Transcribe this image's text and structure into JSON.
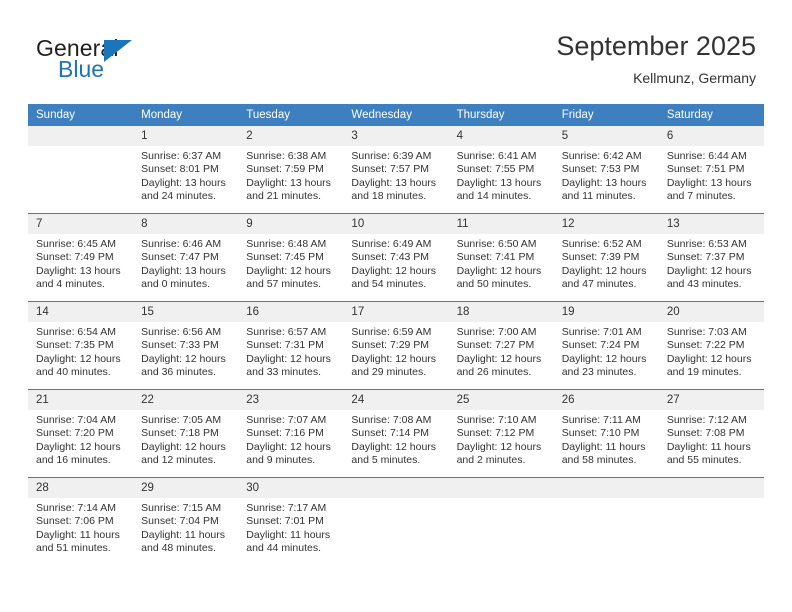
{
  "brand": {
    "name_part1": "General",
    "name_part2": "Blue",
    "accent_color": "#1b75bb"
  },
  "header": {
    "title": "September 2025",
    "subtitle": "Kellmunz, Germany",
    "header_bg_color": "#3d7fbf",
    "daynum_band_color": "#f0f0f0"
  },
  "weekdays": [
    "Sunday",
    "Monday",
    "Tuesday",
    "Wednesday",
    "Thursday",
    "Friday",
    "Saturday"
  ],
  "labels": {
    "sunrise": "Sunrise:",
    "sunset": "Sunset:",
    "daylight": "Daylight:"
  },
  "weeks": [
    [
      {
        "day": "",
        "sunrise": "",
        "sunset": "",
        "daylight": ""
      },
      {
        "day": "1",
        "sunrise": "Sunrise: 6:37 AM",
        "sunset": "Sunset: 8:01 PM",
        "daylight": "Daylight: 13 hours and 24 minutes."
      },
      {
        "day": "2",
        "sunrise": "Sunrise: 6:38 AM",
        "sunset": "Sunset: 7:59 PM",
        "daylight": "Daylight: 13 hours and 21 minutes."
      },
      {
        "day": "3",
        "sunrise": "Sunrise: 6:39 AM",
        "sunset": "Sunset: 7:57 PM",
        "daylight": "Daylight: 13 hours and 18 minutes."
      },
      {
        "day": "4",
        "sunrise": "Sunrise: 6:41 AM",
        "sunset": "Sunset: 7:55 PM",
        "daylight": "Daylight: 13 hours and 14 minutes."
      },
      {
        "day": "5",
        "sunrise": "Sunrise: 6:42 AM",
        "sunset": "Sunset: 7:53 PM",
        "daylight": "Daylight: 13 hours and 11 minutes."
      },
      {
        "day": "6",
        "sunrise": "Sunrise: 6:44 AM",
        "sunset": "Sunset: 7:51 PM",
        "daylight": "Daylight: 13 hours and 7 minutes."
      }
    ],
    [
      {
        "day": "7",
        "sunrise": "Sunrise: 6:45 AM",
        "sunset": "Sunset: 7:49 PM",
        "daylight": "Daylight: 13 hours and 4 minutes."
      },
      {
        "day": "8",
        "sunrise": "Sunrise: 6:46 AM",
        "sunset": "Sunset: 7:47 PM",
        "daylight": "Daylight: 13 hours and 0 minutes."
      },
      {
        "day": "9",
        "sunrise": "Sunrise: 6:48 AM",
        "sunset": "Sunset: 7:45 PM",
        "daylight": "Daylight: 12 hours and 57 minutes."
      },
      {
        "day": "10",
        "sunrise": "Sunrise: 6:49 AM",
        "sunset": "Sunset: 7:43 PM",
        "daylight": "Daylight: 12 hours and 54 minutes."
      },
      {
        "day": "11",
        "sunrise": "Sunrise: 6:50 AM",
        "sunset": "Sunset: 7:41 PM",
        "daylight": "Daylight: 12 hours and 50 minutes."
      },
      {
        "day": "12",
        "sunrise": "Sunrise: 6:52 AM",
        "sunset": "Sunset: 7:39 PM",
        "daylight": "Daylight: 12 hours and 47 minutes."
      },
      {
        "day": "13",
        "sunrise": "Sunrise: 6:53 AM",
        "sunset": "Sunset: 7:37 PM",
        "daylight": "Daylight: 12 hours and 43 minutes."
      }
    ],
    [
      {
        "day": "14",
        "sunrise": "Sunrise: 6:54 AM",
        "sunset": "Sunset: 7:35 PM",
        "daylight": "Daylight: 12 hours and 40 minutes."
      },
      {
        "day": "15",
        "sunrise": "Sunrise: 6:56 AM",
        "sunset": "Sunset: 7:33 PM",
        "daylight": "Daylight: 12 hours and 36 minutes."
      },
      {
        "day": "16",
        "sunrise": "Sunrise: 6:57 AM",
        "sunset": "Sunset: 7:31 PM",
        "daylight": "Daylight: 12 hours and 33 minutes."
      },
      {
        "day": "17",
        "sunrise": "Sunrise: 6:59 AM",
        "sunset": "Sunset: 7:29 PM",
        "daylight": "Daylight: 12 hours and 29 minutes."
      },
      {
        "day": "18",
        "sunrise": "Sunrise: 7:00 AM",
        "sunset": "Sunset: 7:27 PM",
        "daylight": "Daylight: 12 hours and 26 minutes."
      },
      {
        "day": "19",
        "sunrise": "Sunrise: 7:01 AM",
        "sunset": "Sunset: 7:24 PM",
        "daylight": "Daylight: 12 hours and 23 minutes."
      },
      {
        "day": "20",
        "sunrise": "Sunrise: 7:03 AM",
        "sunset": "Sunset: 7:22 PM",
        "daylight": "Daylight: 12 hours and 19 minutes."
      }
    ],
    [
      {
        "day": "21",
        "sunrise": "Sunrise: 7:04 AM",
        "sunset": "Sunset: 7:20 PM",
        "daylight": "Daylight: 12 hours and 16 minutes."
      },
      {
        "day": "22",
        "sunrise": "Sunrise: 7:05 AM",
        "sunset": "Sunset: 7:18 PM",
        "daylight": "Daylight: 12 hours and 12 minutes."
      },
      {
        "day": "23",
        "sunrise": "Sunrise: 7:07 AM",
        "sunset": "Sunset: 7:16 PM",
        "daylight": "Daylight: 12 hours and 9 minutes."
      },
      {
        "day": "24",
        "sunrise": "Sunrise: 7:08 AM",
        "sunset": "Sunset: 7:14 PM",
        "daylight": "Daylight: 12 hours and 5 minutes."
      },
      {
        "day": "25",
        "sunrise": "Sunrise: 7:10 AM",
        "sunset": "Sunset: 7:12 PM",
        "daylight": "Daylight: 12 hours and 2 minutes."
      },
      {
        "day": "26",
        "sunrise": "Sunrise: 7:11 AM",
        "sunset": "Sunset: 7:10 PM",
        "daylight": "Daylight: 11 hours and 58 minutes."
      },
      {
        "day": "27",
        "sunrise": "Sunrise: 7:12 AM",
        "sunset": "Sunset: 7:08 PM",
        "daylight": "Daylight: 11 hours and 55 minutes."
      }
    ],
    [
      {
        "day": "28",
        "sunrise": "Sunrise: 7:14 AM",
        "sunset": "Sunset: 7:06 PM",
        "daylight": "Daylight: 11 hours and 51 minutes."
      },
      {
        "day": "29",
        "sunrise": "Sunrise: 7:15 AM",
        "sunset": "Sunset: 7:04 PM",
        "daylight": "Daylight: 11 hours and 48 minutes."
      },
      {
        "day": "30",
        "sunrise": "Sunrise: 7:17 AM",
        "sunset": "Sunset: 7:01 PM",
        "daylight": "Daylight: 11 hours and 44 minutes."
      },
      {
        "day": "",
        "sunrise": "",
        "sunset": "",
        "daylight": ""
      },
      {
        "day": "",
        "sunrise": "",
        "sunset": "",
        "daylight": ""
      },
      {
        "day": "",
        "sunrise": "",
        "sunset": "",
        "daylight": ""
      },
      {
        "day": "",
        "sunrise": "",
        "sunset": "",
        "daylight": ""
      }
    ]
  ]
}
